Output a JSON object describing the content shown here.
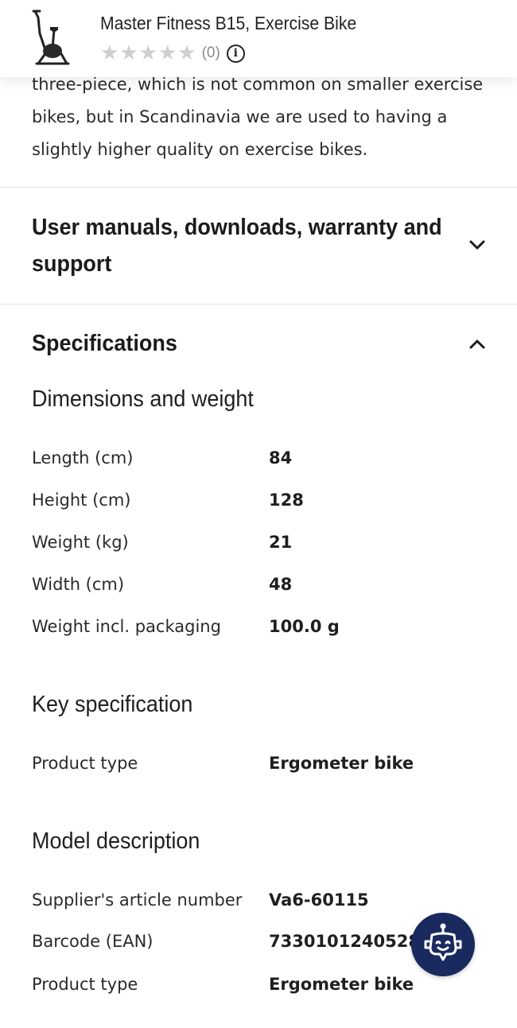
{
  "header": {
    "product_name": "Master Fitness B15, Exercise Bike",
    "rating_stars": 0,
    "review_count": "(0)",
    "star_glyph": "★",
    "info_glyph": "i"
  },
  "description": {
    "text": "three-piece, which is not common on smaller exercise bikes, but in Scandinavia we are used to having a slightly higher quality on exercise bikes."
  },
  "sections": {
    "manuals": {
      "title": "User manuals, downloads, warranty and support",
      "expanded": false
    },
    "specifications": {
      "title": "Specifications",
      "expanded": true
    }
  },
  "specs": {
    "dimensions": {
      "title": "Dimensions and weight",
      "rows": [
        {
          "label": "Length (cm)",
          "value": "84"
        },
        {
          "label": "Height (cm)",
          "value": "128"
        },
        {
          "label": "Weight (kg)",
          "value": "21"
        },
        {
          "label": "Width (cm)",
          "value": "48"
        },
        {
          "label": "Weight incl. packaging",
          "value": "100.0 g"
        }
      ]
    },
    "key": {
      "title": "Key specification",
      "rows": [
        {
          "label": "Product type",
          "value": "Ergometer bike"
        }
      ]
    },
    "model": {
      "title": "Model description",
      "rows": [
        {
          "label": "Supplier's article number",
          "value": "Va6-60115"
        },
        {
          "label": "Barcode (EAN)",
          "value": "7330101240528"
        },
        {
          "label": "Product type",
          "value": "Ergometer bike"
        }
      ]
    }
  },
  "colors": {
    "accent": "#1a2a5e",
    "star_empty": "#cfcfcf",
    "divider": "#e2e2e2"
  },
  "icons": {
    "assistant": "chatbot-icon",
    "manuals_toggle": "chevron-down-icon",
    "specs_toggle": "chevron-up-icon"
  }
}
